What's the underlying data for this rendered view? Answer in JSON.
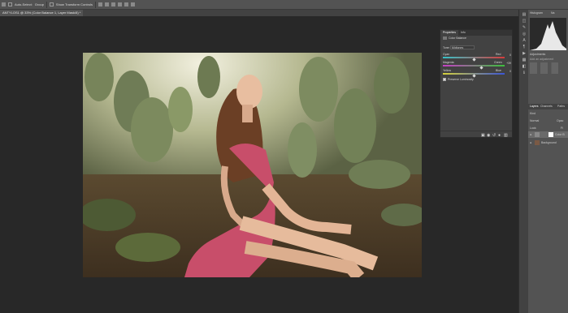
{
  "options_bar": {
    "auto_select_label": "Auto-Select:",
    "group_label": "Group",
    "transform_controls_label": "Show Transform Controls"
  },
  "document_tab": {
    "title": "ANTYLOS1 @ 33% (Color Balance 1, Layer Mask/8) *"
  },
  "right_dock": {
    "histogram_tab": "Histogram",
    "navigator_tab": "Na",
    "adjustments_title": "Adjustments",
    "adjustments_hint": "Add an adjustment",
    "layers_tab": "Layers",
    "channels_tab": "Channels",
    "paths_tab": "Paths",
    "kind_label": "Kind",
    "blend_mode": "Normal",
    "opacity_label": "Opac",
    "lock_label": "Lock:",
    "fill_label": "Fi",
    "layers": [
      {
        "name": "Color B"
      },
      {
        "name": "Background"
      }
    ]
  },
  "properties_panel": {
    "tab_properties": "Properties",
    "tab_info": "Info",
    "header_label": "Color Balance",
    "tone_label": "Tone:",
    "tone_value": "Midtones",
    "sliders": [
      {
        "left": "Cyan",
        "right": "Red",
        "value": "0",
        "knob_fraction": 0.5
      },
      {
        "left": "Magenta",
        "right": "Green",
        "value": "+39",
        "knob_fraction": 0.62
      },
      {
        "left": "Yellow",
        "right": "Blue",
        "value": "0",
        "knob_fraction": 0.5
      }
    ],
    "preserve_luminosity_label": "Preserve Luminosity",
    "preserve_luminosity_checked": true
  },
  "colors": {
    "cyan_red": [
      "#36c2c9",
      "#d63c3c"
    ],
    "magenta_green": [
      "#c53fc5",
      "#3cbf3c"
    ],
    "yellow_blue": [
      "#d6d13a",
      "#3a55d6"
    ]
  }
}
